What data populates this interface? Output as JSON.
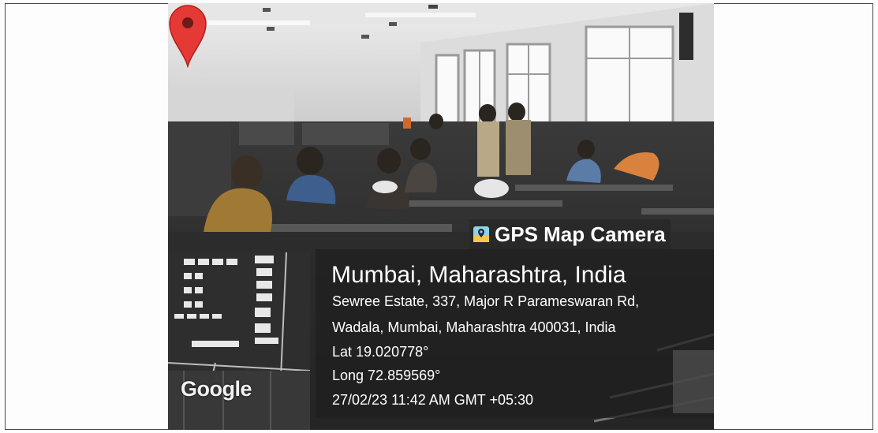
{
  "overlay": {
    "brand_label": "GPS Map Camera",
    "location_title": "Mumbai, Maharashtra, India",
    "address_line_1": "Sewree Estate, 337, Major R Parameswaran Rd,",
    "address_line_2": "Wadala, Mumbai, Maharashtra 400031, India",
    "latitude": "Lat 19.020778°",
    "longitude": "Long 72.859569°",
    "timestamp": "27/02/23 11:42 AM GMT +05:30"
  },
  "map": {
    "logo_text": "Google",
    "pin_color": "#e53935"
  },
  "colors": {
    "overlay_bg": "#1e1e1e",
    "text": "#ffffff"
  },
  "icons": [
    "gps-map-camera-icon",
    "map-pin-icon"
  ]
}
